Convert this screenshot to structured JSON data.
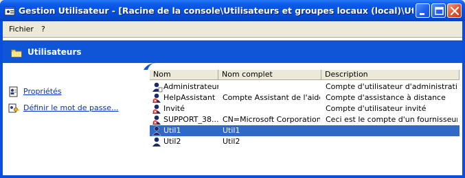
{
  "window": {
    "title": "Gestion Utilisateur - [Racine de la console\\Utilisateurs et groupes locaux (local)\\Utilisateurs]"
  },
  "menu": {
    "file": "Fichier",
    "help": "?"
  },
  "panel": {
    "title": "Utilisateurs"
  },
  "tasks": {
    "properties": "Propriétés",
    "set_password": "Définir le mot de passe..."
  },
  "columns": {
    "name": "Nom",
    "full_name": "Nom complet",
    "description": "Description"
  },
  "users": [
    {
      "name": "Administrateur",
      "full_name": "",
      "description": "Compte d'utilisateur d'administration",
      "disabled": false
    },
    {
      "name": "HelpAssistant",
      "full_name": "Compte Assistant de l'aide...",
      "description": "Compte d'assistance à distance",
      "disabled": true
    },
    {
      "name": "Invité",
      "full_name": "",
      "description": "Compte d'utilisateur invité",
      "disabled": true
    },
    {
      "name": "SUPPORT_38...",
      "full_name": "CN=Microsoft Corporation...",
      "description": "Ceci est le compte d'un fournisseur p...",
      "disabled": true
    },
    {
      "name": "Util1",
      "full_name": "Util1",
      "description": "",
      "disabled": false,
      "selected": true
    },
    {
      "name": "Util2",
      "full_name": "Util2",
      "description": "",
      "disabled": false
    }
  ],
  "colors": {
    "titlebar": "#0550dd",
    "header_band": "#0f56d6",
    "selection": "#3169c6",
    "link": "#0b2ccd"
  }
}
